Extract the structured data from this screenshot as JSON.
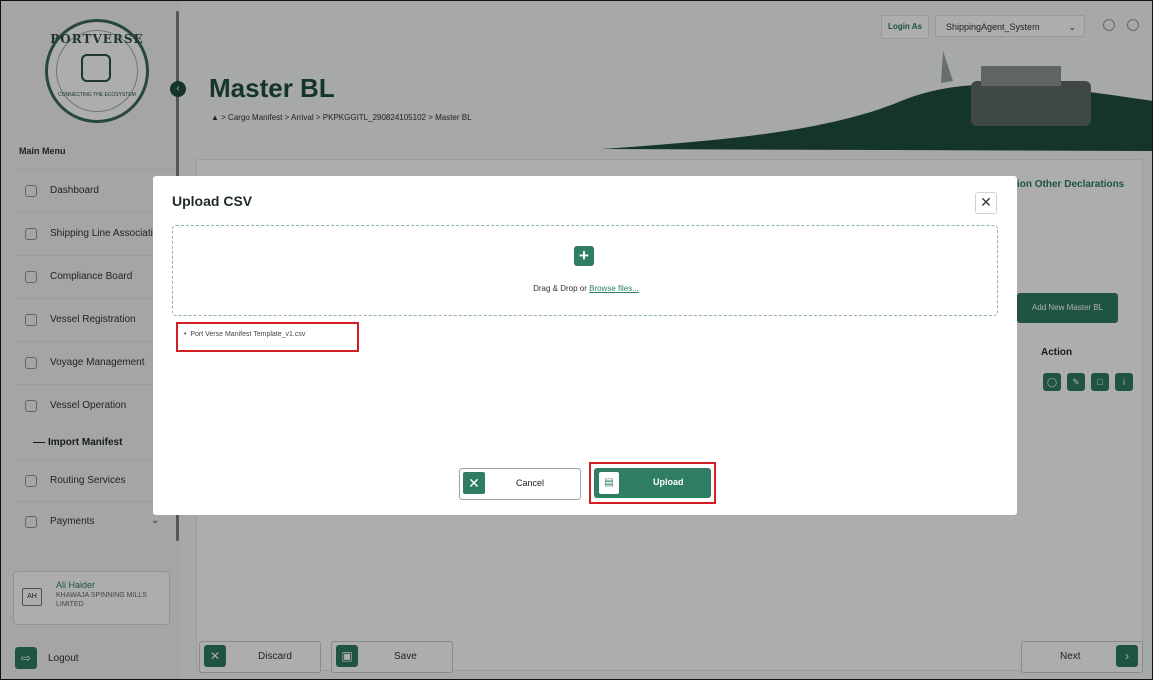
{
  "logo": {
    "top_text": "PORTVERSE",
    "bottom_text": "CONNECTING THE ECOSYSTEM"
  },
  "sidebar": {
    "main_menu": "Main Menu",
    "items": [
      {
        "label": "Dashboard",
        "icon": "dashboard-icon"
      },
      {
        "label": "Shipping Line Association",
        "icon": "shipping-icon"
      },
      {
        "label": "Compliance Board",
        "icon": "compliance-icon"
      },
      {
        "label": "Vessel Registration",
        "icon": "vessel-icon"
      },
      {
        "label": "Voyage Management",
        "icon": "voyage-icon"
      },
      {
        "label": "Vessel Operation",
        "icon": "operation-icon"
      }
    ],
    "sub_item": "Import Manifest",
    "routing": "Routing Services",
    "payments": "Payments",
    "user": {
      "initials": "AH",
      "name": "Ali Haider",
      "org": "KHAWAJA SPINNING MILLS LIMITED"
    },
    "logout": "Logout"
  },
  "topbar": {
    "login_as": "Login As",
    "selected_user": "ShippingAgent_System"
  },
  "header": {
    "title": "Master BL",
    "breadcrumb": [
      "Cargo Manifest",
      "Arrival",
      "PKPKGGITL_290824105102",
      "Master BL"
    ]
  },
  "content": {
    "other_declarations": "ion  Other Declarations",
    "add_button": "Add New Master BL",
    "action_header": "Action"
  },
  "footer": {
    "discard": "Discard",
    "save": "Save",
    "next": "Next"
  },
  "modal": {
    "title": "Upload CSV",
    "drop_prefix": "Drag & Drop or ",
    "browse_link": "Browse files...",
    "file_name": "Port Verse Manifest Template_v1.csv",
    "cancel": "Cancel",
    "upload": "Upload"
  },
  "colors": {
    "brand": "#2e7d64",
    "brand_dark": "#1f4d40",
    "highlight": "#d31e25"
  }
}
